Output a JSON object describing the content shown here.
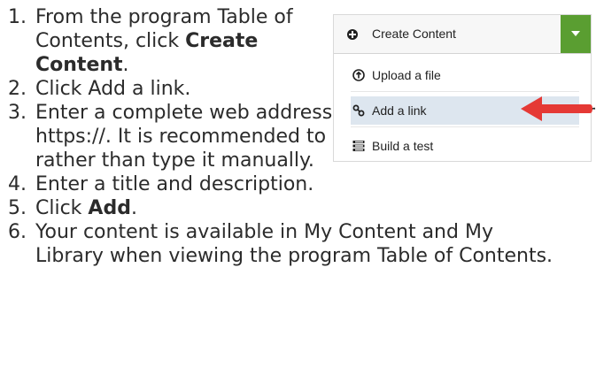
{
  "instructions": {
    "steps": [
      {
        "number": "1.",
        "before": "From the program Table of Contents, click ",
        "bold": "Create Content",
        "after": "."
      },
      {
        "number": "2.",
        "text": "Click Add a link."
      },
      {
        "number": "3.",
        "text": "Enter a complete web address that includes the http:// or https://. It is recommended to copy and paste the URL rather than type it manually."
      },
      {
        "number": "4.",
        "text": "Enter a title and description."
      },
      {
        "number": "5.",
        "before": "Click ",
        "bold": "Add",
        "after": "."
      },
      {
        "number": "6.",
        "text": "Your content is available in My Content and My Library when viewing the program Table of Contents."
      }
    ]
  },
  "ui_panel": {
    "header": {
      "label": "Create Content",
      "icon": "plus-circle-icon"
    },
    "toggle_icon": "caret-down-icon",
    "accent_color": "#5a9e31",
    "highlight_color": "#dde6ef",
    "menu_items": [
      {
        "label": "Upload a file",
        "icon": "upload-icon"
      },
      {
        "label": "Add a link",
        "icon": "link-icon",
        "highlighted": true
      },
      {
        "label": "Build a test",
        "icon": "test-list-icon"
      }
    ],
    "callout": {
      "icon": "red-arrow-icon",
      "color": "#e53935"
    }
  }
}
